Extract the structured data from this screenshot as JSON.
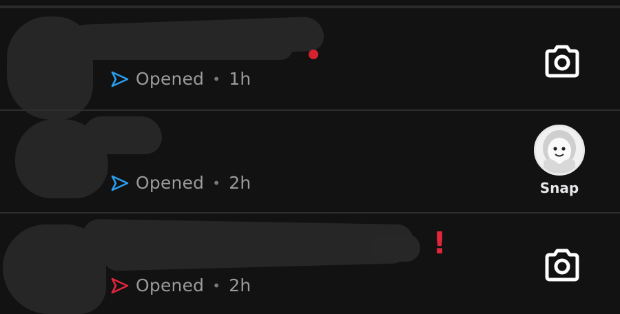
{
  "chats": [
    {
      "status": "Opened",
      "time": "1h",
      "arrow_color": "#2a9ff0",
      "action_icon": "camera-icon"
    },
    {
      "status": "Opened",
      "time": "2h",
      "arrow_color": "#2a9ff0",
      "action_label": "Snap",
      "action_icon": "snap-avatar"
    },
    {
      "status": "Opened",
      "time": "2h",
      "arrow_color": "#e2263c",
      "action_icon": "camera-icon",
      "mark": "!"
    }
  ],
  "separator": "•"
}
